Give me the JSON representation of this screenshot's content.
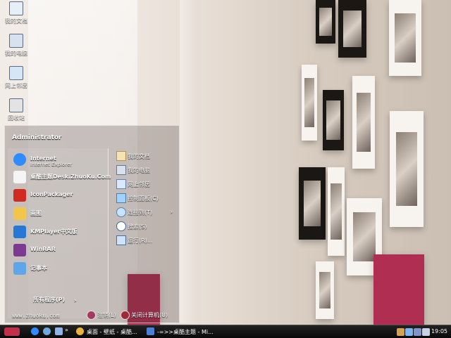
{
  "desktop": {
    "icons": [
      {
        "label": "我的文档",
        "icon": "folder-icon"
      },
      {
        "label": "我的电脑",
        "icon": "computer-icon"
      },
      {
        "label": "网上邻居",
        "icon": "network-icon"
      },
      {
        "label": "回收站",
        "icon": "recycle-bin-icon"
      }
    ]
  },
  "start_menu": {
    "user": "Administrator",
    "programs": [
      {
        "title": "Internet",
        "subtitle": "Internet Explorer",
        "icon": "internet-explorer-icon"
      },
      {
        "title": "桌酷主题Desk.ZhuoKu.Com",
        "icon": "theme-icon"
      },
      {
        "title": "IconPackager",
        "icon": "iconpackager-icon"
      },
      {
        "title": "画图",
        "icon": "paint-icon"
      },
      {
        "title": "KMPlayer中文版",
        "icon": "kmplayer-icon"
      },
      {
        "title": "WinRAR",
        "icon": "winrar-icon"
      },
      {
        "title": "记事本",
        "icon": "notepad-icon"
      }
    ],
    "places": [
      {
        "label": "我的文档",
        "icon": "documents-folder-icon"
      },
      {
        "label": "我的电脑",
        "icon": "computer-icon"
      },
      {
        "label": "网上邻居",
        "icon": "network-places-icon"
      },
      {
        "label": "控制面板(C)",
        "icon": "control-panel-icon"
      },
      {
        "label": "连接到(T)",
        "icon": "connect-icon",
        "arrow": "›"
      },
      {
        "label": "搜索(S)",
        "icon": "search-icon"
      },
      {
        "label": "运行(R)...",
        "icon": "run-icon"
      }
    ],
    "all_programs": "所有程序(P)",
    "all_programs_arrow": "›",
    "footer_url": "www.zhuoku.com",
    "logoff": "注销(L)",
    "shutdown": "关闭计算机(U)"
  },
  "taskbar": {
    "start_icon": "start-logo-icon",
    "quick_launch": [
      "ie-icon",
      "media-icon",
      "show-desktop-icon"
    ],
    "more": "»",
    "windows": [
      {
        "label": "桌面 - 壁纸 - 桌酷...",
        "icon": "chrome-icon"
      },
      {
        "label": "-=>>桌酷主题 - Mi...",
        "icon": "word-icon"
      }
    ],
    "tray_icons": [
      "volume-icon",
      "network-icon",
      "security-icon",
      "ime-icon"
    ],
    "clock": "19:05"
  },
  "colors": {
    "menu_border": "#ffffff",
    "accent_pink": "#b12e53",
    "taskbar": "#111111"
  }
}
